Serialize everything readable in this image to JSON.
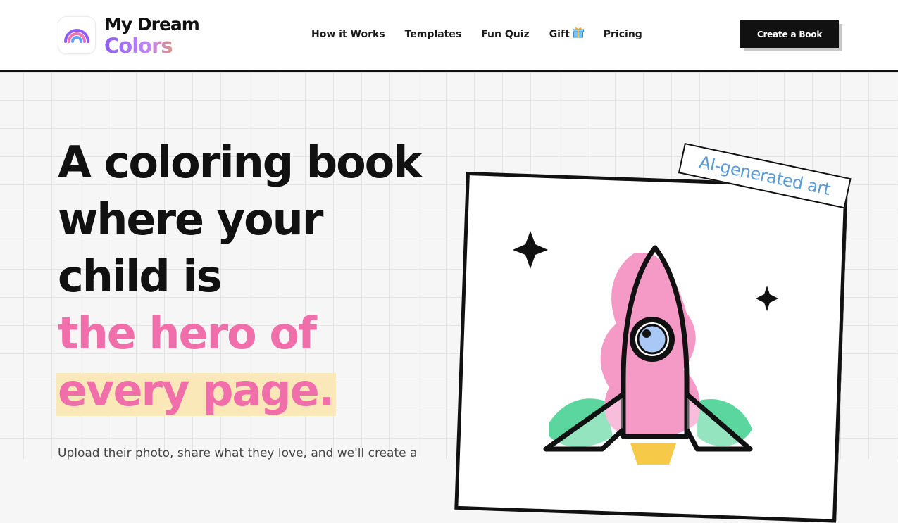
{
  "brand": {
    "line1": "My Dream",
    "line2": "Colors",
    "logo_icon": "rainbow-icon"
  },
  "nav": {
    "items": [
      {
        "label": "How it Works"
      },
      {
        "label": "Templates"
      },
      {
        "label": "Fun Quiz"
      },
      {
        "label": "Gift",
        "icon": "gift-icon"
      },
      {
        "label": "Pricing"
      }
    ]
  },
  "header": {
    "cta_label": "Create a Book"
  },
  "hero": {
    "title_line1": "A coloring book",
    "title_line2": "where your",
    "title_line3": "child is",
    "highlight_line1": "the hero of",
    "highlight_line2": "every page.",
    "subtext": "Upload their photo, share what they love, and we'll create a",
    "tag_label": "AI-generated art"
  },
  "colors": {
    "accent_pink": "#f06eaa",
    "highlight_yellow": "#fbe8b8",
    "tag_blue": "#5b9bd5",
    "rocket_pink": "#f59ac6",
    "flame_green": "#3ecf8e"
  }
}
